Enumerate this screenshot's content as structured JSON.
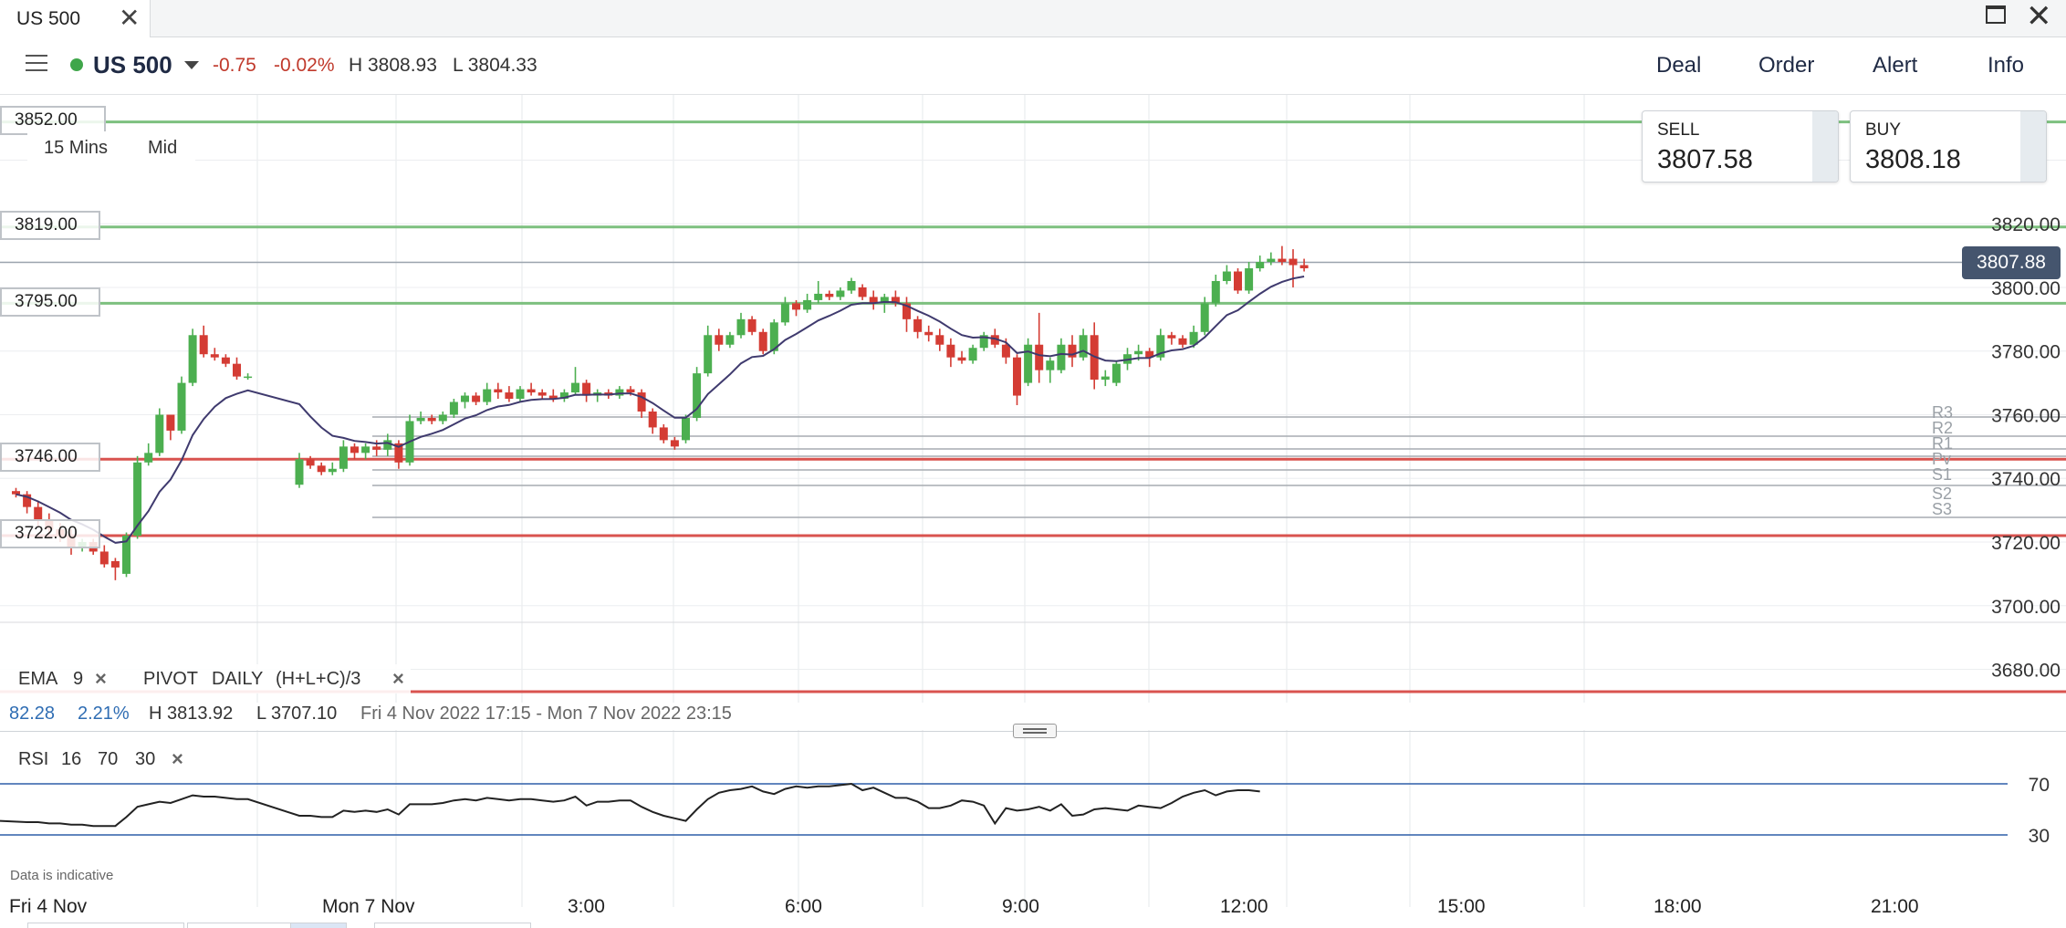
{
  "window": {
    "tab_title": "US 500",
    "close_glyph": "✕"
  },
  "toolbar": {
    "instrument": "US 500",
    "change": "-0.75",
    "change_pct": "-0.02%",
    "high": "H 3808.93",
    "low": "L 3804.33",
    "nav": [
      "Deal",
      "Order",
      "Alert",
      "Info"
    ]
  },
  "chart_controls": {
    "interval": "15 Mins",
    "price_type": "Mid"
  },
  "quotes": {
    "sell": {
      "label": "SELL",
      "value": "3807.58"
    },
    "buy": {
      "label": "BUY",
      "value": "3808.18"
    }
  },
  "price_axis": [
    "3820.00",
    "3800.00",
    "3780.00",
    "3760.00",
    "3740.00",
    "3720.00",
    "3700.00",
    "3680.00"
  ],
  "current_price": "3807.88",
  "level_tags": [
    {
      "label": "3852.00",
      "price": 3852,
      "color": "#7dc07f"
    },
    {
      "label": "3819.00",
      "price": 3819,
      "color": "#7dc07f"
    },
    {
      "label": "3795.00",
      "price": 3795,
      "color": "#7dc07f"
    },
    {
      "label": "3746.00",
      "price": 3746,
      "color": "#d9534f"
    },
    {
      "label": "3722.00",
      "price": 3722,
      "color": "#d9534f"
    }
  ],
  "pivot_labels": [
    "R3",
    "R2",
    "R1",
    "Pv",
    "S1",
    "S2",
    "S3"
  ],
  "indicators": {
    "ema": {
      "name": "EMA",
      "period": "9"
    },
    "pivot": {
      "name": "PIVOT",
      "period": "DAILY",
      "formula": "(H+L+C)/3"
    },
    "rsi": {
      "name": "RSI",
      "period": "16",
      "upper": "70",
      "lower": "30"
    }
  },
  "range_info": {
    "change": "82.28",
    "change_pct": "2.21%",
    "high": "H 3813.92",
    "low": "L 3707.10",
    "period": "Fri 4 Nov 2022 17:15 - Mon 7 Nov 2022 23:15"
  },
  "rsi_axis": [
    "70",
    "30"
  ],
  "disclaimer": "Data is indicative",
  "time_axis": [
    "Fri 4 Nov",
    "Mon 7 Nov",
    "3:00",
    "6:00",
    "9:00",
    "12:00",
    "15:00",
    "18:00",
    "21:00"
  ],
  "colors": {
    "up": "#4caf50",
    "down": "#d43c34",
    "ema": "#3f3a6e",
    "accent": "#1f2a44",
    "negative": "#c0392b"
  },
  "chart_data": {
    "type": "candlestick",
    "interval": "15 Mins",
    "ylim": [
      3670,
      3835
    ],
    "ema_period": 9,
    "candles": [
      [
        3736,
        3737,
        3734,
        3735
      ],
      [
        3735,
        3736,
        3729,
        3731
      ],
      [
        3731,
        3733,
        3725,
        3727
      ],
      [
        3727,
        3729,
        3722,
        3724
      ],
      [
        3724,
        3726,
        3720,
        3722
      ],
      [
        3722,
        3724,
        3716,
        3718
      ],
      [
        3718,
        3721,
        3717,
        3720
      ],
      [
        3720,
        3721,
        3716,
        3717
      ],
      [
        3717,
        3719,
        3712,
        3713
      ],
      [
        3714,
        3715,
        3708,
        3712
      ],
      [
        3710,
        3723,
        3709,
        3722
      ],
      [
        3722,
        3747,
        3721,
        3745
      ],
      [
        3745,
        3751,
        3744,
        3748
      ],
      [
        3748,
        3762,
        3747,
        3760
      ],
      [
        3760,
        3759,
        3752,
        3755
      ],
      [
        3755,
        3772,
        3754,
        3770
      ],
      [
        3770,
        3787,
        3769,
        3785
      ],
      [
        3785,
        3788,
        3778,
        3779
      ],
      [
        3779,
        3781,
        3777,
        3778
      ],
      [
        3778,
        3779,
        3775,
        3776
      ],
      [
        3776,
        3778,
        3771,
        3772
      ],
      [
        3772,
        3773,
        3771,
        3772
      ],
      [
        3738,
        3748,
        3737,
        3746
      ],
      [
        3746,
        3747,
        3743,
        3744
      ],
      [
        3744,
        3745,
        3741,
        3742
      ],
      [
        3742,
        3745,
        3741,
        3743
      ],
      [
        3743,
        3752,
        3742,
        3750
      ],
      [
        3750,
        3751,
        3746,
        3748
      ],
      [
        3748,
        3751,
        3746,
        3750
      ],
      [
        3750,
        3752,
        3747,
        3749
      ],
      [
        3749,
        3754,
        3747,
        3752
      ],
      [
        3751,
        3752,
        3743,
        3745
      ],
      [
        3745,
        3760,
        3744,
        3758
      ],
      [
        3758,
        3761,
        3757,
        3759
      ],
      [
        3759,
        3760,
        3757,
        3758
      ],
      [
        3758,
        3761,
        3757,
        3760
      ],
      [
        3760,
        3765,
        3759,
        3764
      ],
      [
        3764,
        3767,
        3762,
        3766
      ],
      [
        3766,
        3767,
        3763,
        3764
      ],
      [
        3764,
        3770,
        3763,
        3768
      ],
      [
        3768,
        3770,
        3765,
        3767
      ],
      [
        3767,
        3769,
        3764,
        3765
      ],
      [
        3765,
        3769,
        3764,
        3768
      ],
      [
        3768,
        3770,
        3766,
        3767
      ],
      [
        3767,
        3768,
        3765,
        3766
      ],
      [
        3766,
        3768,
        3764,
        3765
      ],
      [
        3765,
        3768,
        3764,
        3767
      ],
      [
        3767,
        3775,
        3766,
        3770
      ],
      [
        3770,
        3771,
        3764,
        3766
      ],
      [
        3766,
        3768,
        3764,
        3767
      ],
      [
        3767,
        3768,
        3765,
        3766
      ],
      [
        3766,
        3769,
        3765,
        3768
      ],
      [
        3768,
        3769,
        3766,
        3767
      ],
      [
        3767,
        3768,
        3759,
        3761
      ],
      [
        3761,
        3762,
        3754,
        3756
      ],
      [
        3756,
        3757,
        3751,
        3752
      ],
      [
        3752,
        3753,
        3749,
        3750
      ],
      [
        3752,
        3760,
        3751,
        3759
      ],
      [
        3759,
        3775,
        3758,
        3773
      ],
      [
        3773,
        3788,
        3772,
        3785
      ],
      [
        3785,
        3787,
        3780,
        3782
      ],
      [
        3782,
        3786,
        3781,
        3785
      ],
      [
        3785,
        3792,
        3784,
        3790
      ],
      [
        3790,
        3791,
        3785,
        3786
      ],
      [
        3786,
        3787,
        3779,
        3780
      ],
      [
        3780,
        3790,
        3779,
        3789
      ],
      [
        3789,
        3797,
        3788,
        3795
      ],
      [
        3795,
        3796,
        3791,
        3793
      ],
      [
        3793,
        3798,
        3792,
        3796
      ],
      [
        3796,
        3802,
        3795,
        3798
      ],
      [
        3798,
        3799,
        3796,
        3797
      ],
      [
        3797,
        3800,
        3796,
        3799
      ],
      [
        3799,
        3803,
        3798,
        3802
      ],
      [
        3800,
        3801,
        3796,
        3797
      ],
      [
        3797,
        3799,
        3793,
        3795
      ],
      [
        3795,
        3798,
        3792,
        3797
      ],
      [
        3797,
        3799,
        3794,
        3795
      ],
      [
        3795,
        3797,
        3786,
        3790
      ],
      [
        3790,
        3791,
        3784,
        3786
      ],
      [
        3786,
        3788,
        3783,
        3785
      ],
      [
        3785,
        3787,
        3780,
        3782
      ],
      [
        3782,
        3784,
        3775,
        3778
      ],
      [
        3778,
        3780,
        3776,
        3777
      ],
      [
        3777,
        3782,
        3776,
        3781
      ],
      [
        3781,
        3786,
        3780,
        3785
      ],
      [
        3785,
        3787,
        3781,
        3782
      ],
      [
        3782,
        3784,
        3776,
        3778
      ],
      [
        3778,
        3779,
        3763,
        3766
      ],
      [
        3770,
        3784,
        3769,
        3782
      ],
      [
        3782,
        3792,
        3770,
        3774
      ],
      [
        3774,
        3778,
        3770,
        3777
      ],
      [
        3774,
        3784,
        3773,
        3782
      ],
      [
        3782,
        3785,
        3775,
        3778
      ],
      [
        3778,
        3787,
        3777,
        3785
      ],
      [
        3785,
        3789,
        3768,
        3771
      ],
      [
        3771,
        3774,
        3769,
        3772
      ],
      [
        3770,
        3777,
        3769,
        3776
      ],
      [
        3776,
        3781,
        3774,
        3779
      ],
      [
        3779,
        3782,
        3777,
        3780
      ],
      [
        3780,
        3781,
        3775,
        3778
      ],
      [
        3778,
        3787,
        3777,
        3785
      ],
      [
        3785,
        3786,
        3782,
        3784
      ],
      [
        3784,
        3785,
        3781,
        3782
      ],
      [
        3782,
        3788,
        3781,
        3786
      ],
      [
        3786,
        3797,
        3785,
        3795
      ],
      [
        3795,
        3804,
        3794,
        3802
      ],
      [
        3802,
        3807,
        3801,
        3805
      ],
      [
        3805,
        3806,
        3798,
        3799
      ],
      [
        3799,
        3808,
        3798,
        3806
      ],
      [
        3806,
        3810,
        3805,
        3808
      ],
      [
        3808,
        3811,
        3807,
        3809
      ],
      [
        3809,
        3813,
        3807,
        3808
      ],
      [
        3809,
        3812,
        3800,
        3807
      ],
      [
        3807,
        3809,
        3805,
        3806
      ]
    ],
    "pivot_levels": {
      "R3": 3760,
      "R2": 3754,
      "R1": 3750,
      "Pv": 3746,
      "S1": 3742,
      "S2": 3733,
      "S3": 3727
    },
    "rsi": {
      "ylim": [
        0,
        100
      ],
      "upper": 70,
      "lower": 30,
      "values": [
        41,
        40,
        40,
        39,
        39,
        38,
        38,
        37,
        37,
        37,
        44,
        52,
        54,
        56,
        55,
        58,
        61,
        60,
        60,
        59,
        58,
        58,
        45,
        45,
        44,
        44,
        49,
        48,
        49,
        48,
        50,
        46,
        54,
        54,
        54,
        55,
        57,
        58,
        57,
        59,
        58,
        57,
        58,
        58,
        57,
        56,
        57,
        60,
        53,
        56,
        56,
        57,
        57,
        52,
        48,
        45,
        43,
        41,
        50,
        58,
        63,
        65,
        66,
        68,
        64,
        62,
        66,
        68,
        67,
        68,
        68,
        69,
        70,
        65,
        67,
        63,
        59,
        59,
        56,
        51,
        51,
        53,
        57,
        56,
        53,
        39,
        51,
        49,
        50,
        52,
        49,
        54,
        45,
        46,
        50,
        51,
        50,
        49,
        53,
        52,
        51,
        55,
        60,
        63,
        65,
        61,
        64,
        65,
        65,
        64
      ]
    }
  }
}
